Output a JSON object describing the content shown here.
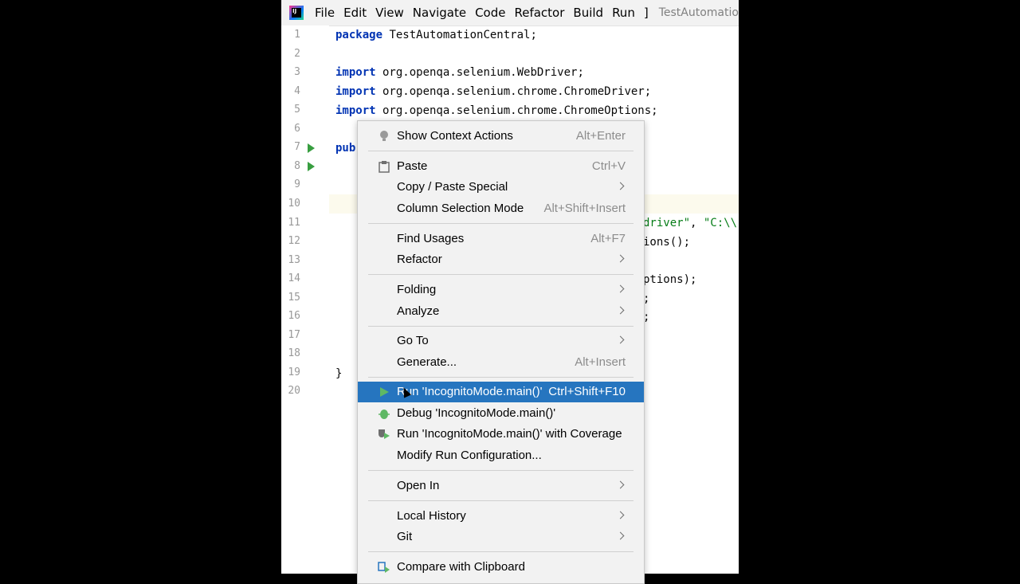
{
  "menubar": {
    "items": [
      "File",
      "Edit",
      "View",
      "Navigate",
      "Code",
      "Refactor",
      "Build",
      "Run",
      "]"
    ],
    "project_title": "TestAutomationCent"
  },
  "editor": {
    "line_numbers": [
      "1",
      "2",
      "3",
      "4",
      "5",
      "6",
      "7",
      "8",
      "9",
      "10",
      "11",
      "12",
      "13",
      "14",
      "15",
      "16",
      "17",
      "18",
      "19",
      "20"
    ],
    "lines": {
      "l1_kw": "package",
      "l1_rest": " TestAutomationCentral;",
      "l3_kw": "import",
      "l3_rest": " org.openqa.selenium.WebDriver;",
      "l4_kw": "import",
      "l4_rest": " org.openqa.selenium.chrome.ChromeDriver;",
      "l5_kw": "import",
      "l5_rest": " org.openqa.selenium.chrome.ChromeOptions;",
      "l7_partial": "pub",
      "l11_str": "driver\"",
      "l11_rest": ", ",
      "l11_str2": "\"C:\\\\",
      "l12_rest": "ions();",
      "l14_rest": "ptions);",
      "l15_rest": ";",
      "l16_rest": ";",
      "l19": "}"
    }
  },
  "context_menu": {
    "show_context_actions": {
      "label": "Show Context Actions",
      "shortcut": "Alt+Enter"
    },
    "paste": {
      "label": "Paste",
      "shortcut": "Ctrl+V"
    },
    "copy_paste_special": {
      "label": "Copy / Paste Special"
    },
    "column_selection": {
      "label": "Column Selection Mode",
      "shortcut": "Alt+Shift+Insert"
    },
    "find_usages": {
      "label": "Find Usages",
      "shortcut": "Alt+F7"
    },
    "refactor": {
      "label": "Refactor"
    },
    "folding": {
      "label": "Folding"
    },
    "analyze": {
      "label": "Analyze"
    },
    "go_to": {
      "label": "Go To"
    },
    "generate": {
      "label": "Generate...",
      "shortcut": "Alt+Insert"
    },
    "run": {
      "label": "Run 'IncognitoMode.main()'",
      "shortcut": "Ctrl+Shift+F10"
    },
    "debug": {
      "label": "Debug 'IncognitoMode.main()'"
    },
    "run_coverage": {
      "label": "Run 'IncognitoMode.main()' with Coverage"
    },
    "modify_run": {
      "label": "Modify Run Configuration..."
    },
    "open_in": {
      "label": "Open In"
    },
    "local_history": {
      "label": "Local History"
    },
    "git": {
      "label": "Git"
    },
    "compare_clipboard": {
      "label": "Compare with Clipboard"
    }
  },
  "colors": {
    "selection": "#2675bf",
    "run_green": "#389e40",
    "keyword": "#0033b3"
  }
}
